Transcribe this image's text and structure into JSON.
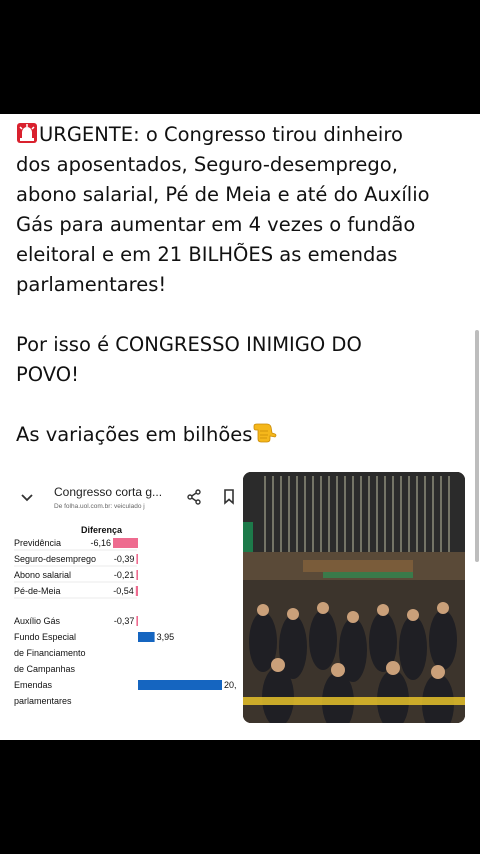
{
  "post": {
    "line1": "URGENTE: o Congresso tirou dinheiro",
    "line2": "dos aposentados, Seguro-desemprego,",
    "line3": "abono salarial, Pé de Meia e até do Auxílio",
    "line4": "Gás para aumentar em 4 vezes o fundão",
    "line5": "eleitoral e em 21 BILHÕES as emendas",
    "line6": "parlamentares!",
    "line7": "Por isso é CONGRESSO INIMIGO DO",
    "line8": "POVO!",
    "line9": "As variações em bilhões"
  },
  "icons": {
    "siren": "siren-emoji-icon",
    "hand": "pointing-down-emoji-icon"
  },
  "card": {
    "title": "Congresso corta g...",
    "url": "De folha.uol.com.br: veiculado j",
    "column_header": "Diferença"
  },
  "chart_data": {
    "type": "bar",
    "orientation": "horizontal",
    "header": "Diferença",
    "categories": [
      "Previdência",
      "Seguro-desemprego",
      "Abono salarial",
      "Pé-de-Meia",
      "Auxílio Gás",
      "Fundo Especial de Financiamento de Campanhas",
      "Emendas parlamentares"
    ],
    "category_lines": [
      [
        "Previdência"
      ],
      [
        "Seguro-desemprego"
      ],
      [
        "Abono salarial"
      ],
      [
        "Pé-de-Meia"
      ],
      [
        "Auxílio Gás"
      ],
      [
        "Fundo Especial",
        "de Financiamento",
        "de Campanhas"
      ],
      [
        "Emendas",
        "parlamentares"
      ]
    ],
    "values": [
      -6.16,
      -0.39,
      -0.21,
      -0.54,
      -0.37,
      3.95,
      20
    ],
    "value_labels": [
      "-6,16",
      "-0,39",
      "-0,21",
      "-0,54",
      "-0,37",
      "3,95",
      "20,"
    ],
    "colors": {
      "negative": "#ee6b8f",
      "positive": "#1565c0"
    }
  }
}
